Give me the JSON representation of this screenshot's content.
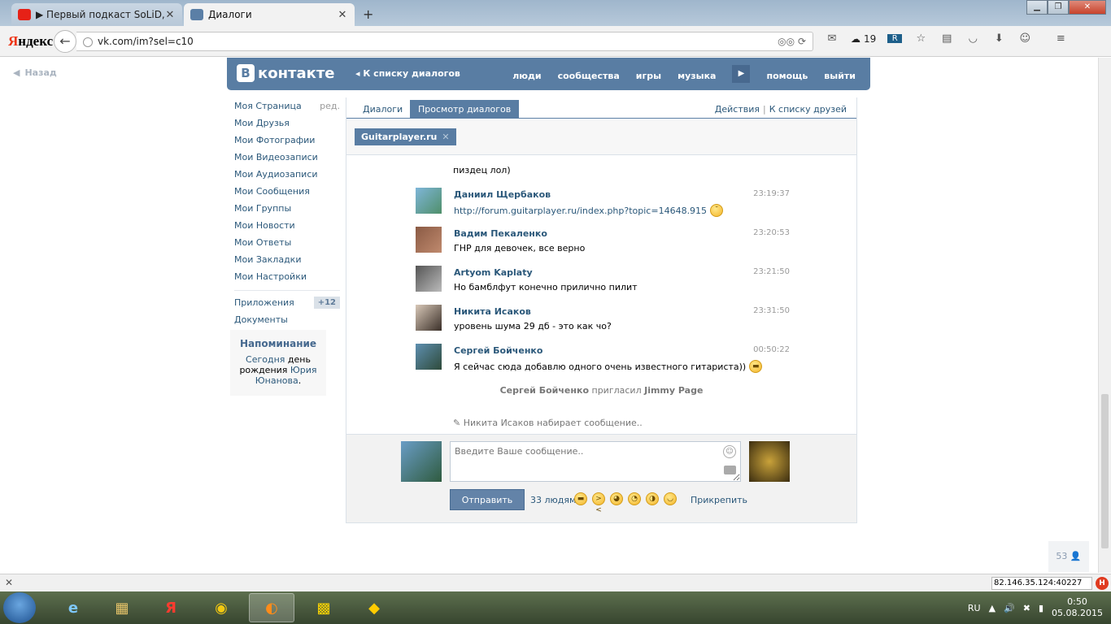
{
  "browser": {
    "tabs": [
      {
        "title": "▶ Первый подкаст SoLiD, ...",
        "active": false
      },
      {
        "title": "Диалоги",
        "active": true
      }
    ],
    "new_tab_symbol": "+",
    "brand_prefix": "Я",
    "brand_rest": "ндекс",
    "url": "vk.com/im?sel=c10",
    "weather_temp": "19"
  },
  "page": {
    "back_label": "Назад",
    "header": {
      "logo_letter": "В",
      "logo_text": "контакте",
      "back_to_list": "К списку диалогов",
      "nav": [
        "люди",
        "сообщества",
        "игры",
        "музыка",
        "помощь",
        "выйти"
      ]
    },
    "sidebar": {
      "items": [
        {
          "label": "Моя Страница",
          "extra": "ред."
        },
        {
          "label": "Мои Друзья"
        },
        {
          "label": "Мои Фотографии"
        },
        {
          "label": "Мои Видеозаписи"
        },
        {
          "label": "Мои Аудиозаписи"
        },
        {
          "label": "Мои Сообщения"
        },
        {
          "label": "Мои Группы"
        },
        {
          "label": "Мои Новости"
        },
        {
          "label": "Мои Ответы"
        },
        {
          "label": "Мои Закладки"
        },
        {
          "label": "Мои Настройки"
        }
      ],
      "apps_label": "Приложения",
      "apps_badge": "+12",
      "docs_label": "Документы",
      "reminder": {
        "title": "Напоминание",
        "today": "Сегодня",
        "text1": " день рождения ",
        "name": "Юрия Юнанова",
        "dot": "."
      }
    },
    "tabs": {
      "dialogs": "Диалоги",
      "view": "Просмотр диалогов",
      "actions": "Действия",
      "separator": "|",
      "friends": "К списку друзей"
    },
    "peer_chip": "Guitarplayer.ru",
    "chip_close": "✕",
    "first_line": "пиздец лол)",
    "messages": [
      {
        "author": "Даниил Щербаков",
        "time": "23:19:37",
        "text": "http://forum.guitarplayer.ru/index.php?topic=14648.915",
        "is_link": true,
        "smiley": true
      },
      {
        "author": "Вадим Пекаленко",
        "time": "23:20:53",
        "text": "ГНР для девочек, все верно",
        "is_link": false,
        "smiley": false
      },
      {
        "author": "Artyom Kaplaty",
        "time": "23:21:50",
        "text": "Но бамблфут конечно прилично пилит",
        "is_link": false,
        "smiley": false
      },
      {
        "author": "Никита Исаков",
        "time": "23:31:50",
        "text": "уровень шума 29 дб - это как чо?",
        "is_link": false,
        "smiley": false
      },
      {
        "author": "Сергей Бойченко",
        "time": "00:50:22",
        "text": "Я сейчас сюда добавлю одного очень известного гитариста))",
        "is_link": false,
        "smiley": true
      }
    ],
    "invite": {
      "who": "Сергей Бойченко",
      "action": "пригласил",
      "whom": "Jimmy Page"
    },
    "typing": "Никита Исаков набирает сообщение..",
    "composer": {
      "placeholder": "Введите Ваше сообщение..",
      "send": "Отправить",
      "to_people": "33 людям",
      "attach": "Прикрепить"
    },
    "online_count": "53"
  },
  "statusbar": {
    "ip": "82.146.35.124:40227"
  },
  "taskbar": {
    "lang": "RU",
    "time": "0:50",
    "date": "05.08.2015"
  },
  "colors": {
    "vk_blue": "#597da3",
    "link": "#2b587a"
  }
}
